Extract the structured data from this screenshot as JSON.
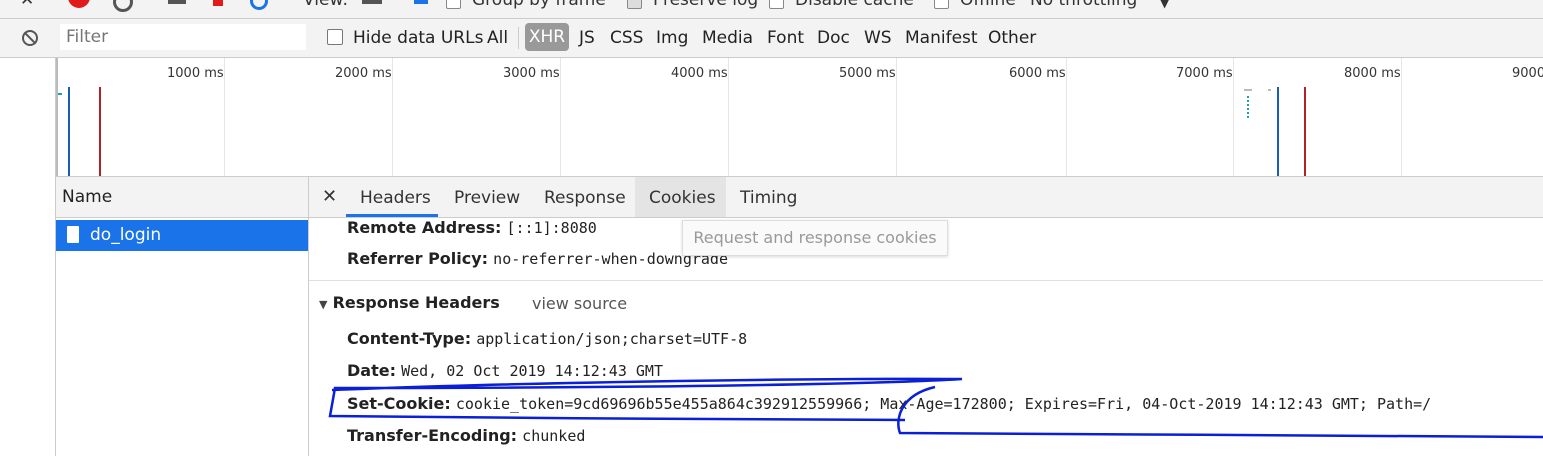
{
  "toolbar": {
    "view_label": "View:",
    "group_by_frame": "Group by frame",
    "preserve_log": "Preserve log",
    "disable_cache": "Disable cache",
    "offline": "Offline",
    "throttling": "No throttling"
  },
  "filter": {
    "placeholder": "Filter",
    "hide_data_urls": "Hide data URLs",
    "types": [
      "All",
      "XHR",
      "JS",
      "CSS",
      "Img",
      "Media",
      "Font",
      "Doc",
      "WS",
      "Manifest",
      "Other"
    ],
    "selected": "XHR"
  },
  "overview": {
    "ticks": [
      "1000 ms",
      "2000 ms",
      "3000 ms",
      "4000 ms",
      "5000 ms",
      "6000 ms",
      "7000 ms",
      "8000 ms",
      "9000"
    ]
  },
  "requests": {
    "column_header": "Name",
    "items": [
      {
        "name": "do_login"
      }
    ]
  },
  "details": {
    "tabs": [
      "Headers",
      "Preview",
      "Response",
      "Cookies",
      "Timing"
    ],
    "active_tab": "Headers",
    "hovered_tab": "Cookies",
    "tooltip": "Request and response cookies",
    "general": [
      {
        "key": "Remote Address:",
        "value": "[::1]:8080"
      },
      {
        "key": "Referrer Policy:",
        "value": "no-referrer-when-downgrade"
      }
    ],
    "response_headers": {
      "title": "Response Headers",
      "view_source": "view source",
      "items": [
        {
          "key": "Content-Type:",
          "value": "application/json;charset=UTF-8"
        },
        {
          "key": "Date:",
          "value": "Wed, 02 Oct 2019 14:12:43 GMT"
        },
        {
          "key": "Set-Cookie:",
          "value": "cookie_token=9cd69696b55e455a864c392912559966; Max-Age=172800; Expires=Fri, 04-Oct-2019 14:12:43 GMT; Path=/"
        },
        {
          "key": "Transfer-Encoding:",
          "value": "chunked"
        }
      ]
    }
  },
  "colors": {
    "accent": "#1a73e8",
    "annotation": "#0a1fd6",
    "dom_line": "#1a5fb4",
    "load_line": "#b22222"
  }
}
